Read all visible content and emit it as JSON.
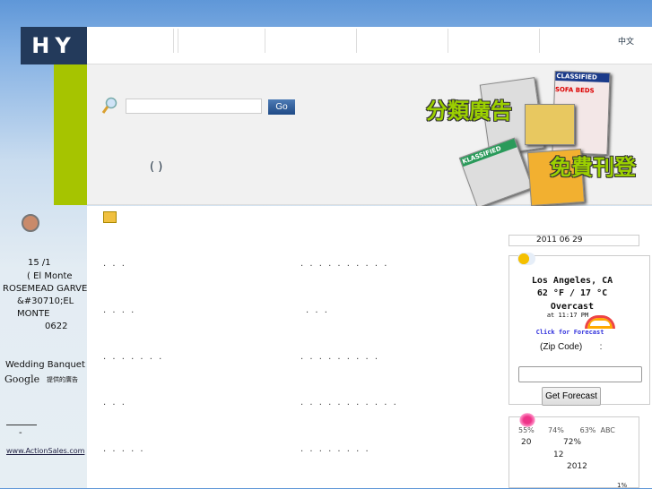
{
  "logo": {
    "text": "HY"
  },
  "nav": {
    "tabs": [
      "",
      "",
      "",
      "",
      "",
      ""
    ],
    "lang": "中文"
  },
  "hero": {
    "go_label": "Go",
    "search_value": "",
    "parens": "(   )",
    "banner_line1": "分類廣告",
    "banner_line2": "免費刊登",
    "papers": [
      "CLASSIFIED",
      "SOFA BEDS",
      "KLASSIFIED"
    ]
  },
  "sidebar": {
    "lines": [
      "15  /1",
      "( El Monte",
      "ROSEMEAD GARVE",
      "&#30710;EL",
      "MONTE",
      "0622"
    ],
    "ad_title": "Wedding Banquet",
    "google": "Google",
    "ad_by": "提供的廣告",
    "dash": "-",
    "link": "www.ActionSales.com"
  },
  "listings": [
    [
      "·   ·   ·",
      "·  ·  ·  ·  ·  ·  ·  ·  ·  ·"
    ],
    [
      "·   ·   ·   ·",
      "·    ·    ·"
    ],
    [
      "·  ·  ·  ·  ·  ·  ·",
      "·  ·  ·  ·  ·  ·  ·  ·  ·"
    ],
    [
      "·    ·    ·",
      "·  ·  ·  ·  ·  ·  ·  ·  ·  ·  ·"
    ],
    [
      "·   ·   ·   ·   ·",
      "·  ·  ·  ·  ·  ·  ·  ·"
    ]
  ],
  "right": {
    "date": "2011 06 29",
    "weather": {
      "city": "Los Angeles, CA",
      "temp": "62 °F / 17 °C",
      "cond": "Overcast",
      "time": "at 11:17 PM",
      "forecast_link": "Click for Forecast",
      "zip_label": "(Zip Code)       :",
      "zip_value": "",
      "button": "Get Forecast"
    },
    "stats": {
      "l1": "55%      74%       63%  ABC",
      "l2a": "20",
      "l2b": "72%",
      "l3": "12",
      "l4": "2012",
      "l5": "1%"
    }
  },
  "colors": {
    "logo_bg": "#233a5b",
    "accent_green": "#a6c400",
    "go_button": "#1f4a86"
  }
}
